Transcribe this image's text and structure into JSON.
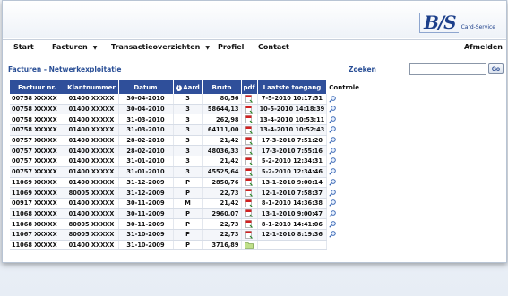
{
  "logo": {
    "mark": "B/S",
    "tagline": "Card-Service"
  },
  "menu": {
    "items": [
      "Start",
      "Facturen",
      "Transactieoverzichten",
      "Profiel",
      "Contact"
    ],
    "right": "Afmelden"
  },
  "section": {
    "title": "Facturen - Netwerkexploitatie",
    "search_label": "Zoeken",
    "search_value": "",
    "go_label": "Go"
  },
  "table": {
    "headers": [
      "Factuur nr.",
      "Klantnummer",
      "Datum",
      "Aard",
      "Bruto",
      "pdf",
      "Laatste toegang",
      "Controle"
    ],
    "rows": [
      [
        "00758 XXXXX",
        "01400 XXXXX",
        "30-04-2010",
        "3",
        "80,56",
        "pdf",
        "7-5-2010 10:17:51",
        "ok"
      ],
      [
        "00758 XXXXX",
        "01400 XXXXX",
        "30-04-2010",
        "3",
        "58644,13",
        "pdf",
        "10-5-2010 14:18:39",
        "ok"
      ],
      [
        "00758 XXXXX",
        "01400 XXXXX",
        "31-03-2010",
        "3",
        "262,98",
        "pdf",
        "13-4-2010 10:53:11",
        "ok"
      ],
      [
        "00758 XXXXX",
        "01400 XXXXX",
        "31-03-2010",
        "3",
        "64111,00",
        "pdf",
        "13-4-2010 10:52:43",
        "ok"
      ],
      [
        "00757 XXXXX",
        "01400 XXXXX",
        "28-02-2010",
        "3",
        "21,42",
        "pdf",
        "17-3-2010 7:51:20",
        "ok"
      ],
      [
        "00757 XXXXX",
        "01400 XXXXX",
        "28-02-2010",
        "3",
        "48036,33",
        "pdf",
        "17-3-2010 7:55:16",
        "ok"
      ],
      [
        "00757 XXXXX",
        "01400 XXXXX",
        "31-01-2010",
        "3",
        "21,42",
        "pdf",
        "5-2-2010 12:34:31",
        "ok"
      ],
      [
        "00757 XXXXX",
        "01400 XXXXX",
        "31-01-2010",
        "3",
        "45525,64",
        "pdf",
        "5-2-2010 12:34:46",
        "ok"
      ],
      [
        "11069 XXXXX",
        "01400 XXXXX",
        "31-12-2009",
        "P",
        "2850,76",
        "pdf",
        "13-1-2010 9:00:14",
        "ok"
      ],
      [
        "11069 XXXXX",
        "80005 XXXXX",
        "31-12-2009",
        "P",
        "22,73",
        "pdf",
        "12-1-2010 7:58:37",
        "ok"
      ],
      [
        "00917 XXXXX",
        "01400 XXXXX",
        "30-11-2009",
        "M",
        "21,42",
        "pdf",
        "8-1-2010 14:36:38",
        "ok"
      ],
      [
        "11068 XXXXX",
        "01400 XXXXX",
        "30-11-2009",
        "P",
        "2960,07",
        "pdf",
        "13-1-2010 9:00:47",
        "ok"
      ],
      [
        "11068 XXXXX",
        "80005 XXXXX",
        "30-11-2009",
        "P",
        "22,73",
        "pdf",
        "8-1-2010 14:41:06",
        "ok"
      ],
      [
        "11067 XXXXX",
        "80005 XXXXX",
        "31-10-2009",
        "P",
        "22,73",
        "pdf",
        "12-1-2010 8:19:36",
        "ok"
      ],
      [
        "11068 XXXXX",
        "01400 XXXXX",
        "31-10-2009",
        "P",
        "3716,89",
        "folder",
        "",
        ""
      ]
    ]
  },
  "reflection_rows": [
    [
      "11068 XXXXX",
      "01400 XXXXX",
      "31-10-2009",
      "P",
      "3716,89"
    ],
    [
      "11067 XXXXX",
      "80005 XXXXX",
      "31-10-2009",
      "P",
      "22,73",
      "12-1-2010 8:19:36"
    ]
  ],
  "colors": {
    "header_bg": "#2f4f9a",
    "accent_text": "#2a4f96"
  }
}
